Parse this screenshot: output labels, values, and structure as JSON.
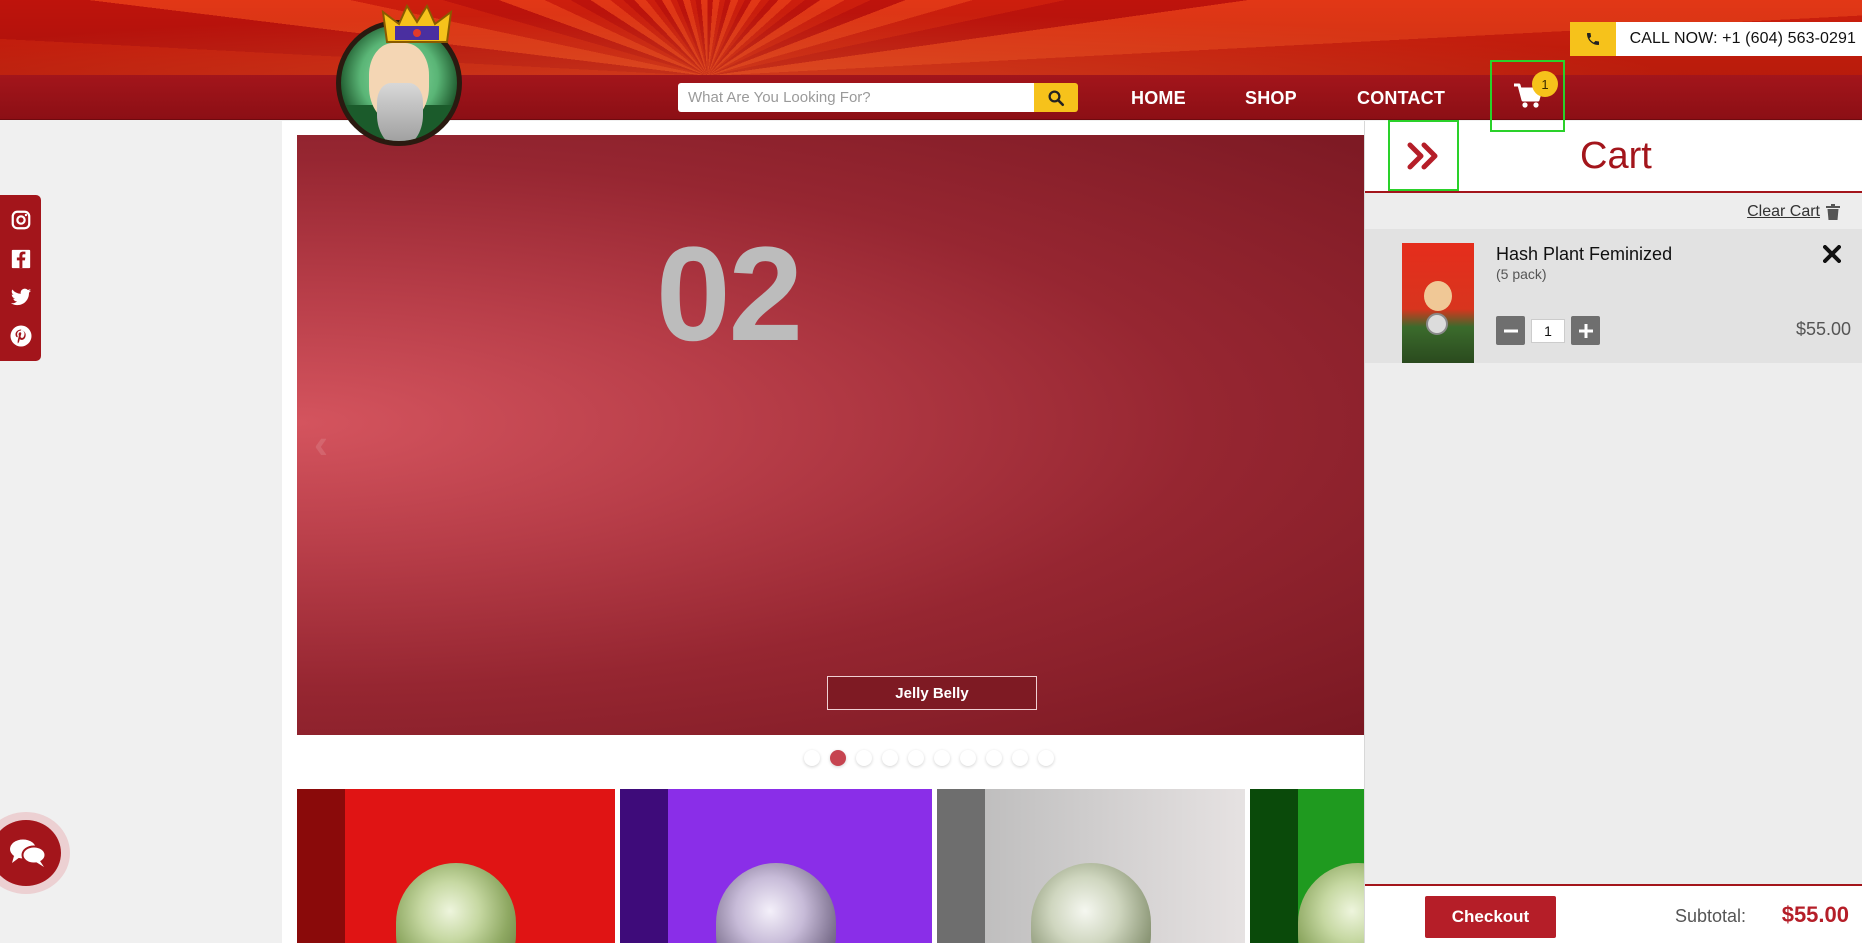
{
  "header": {
    "call": {
      "label": "CALL NOW: +1 (604) 563-0291",
      "icon": "phone-icon"
    },
    "search": {
      "placeholder": "What Are You Looking For?",
      "icon": "search-icon"
    },
    "nav": [
      {
        "label": "HOME"
      },
      {
        "label": "SHOP"
      },
      {
        "label": "CONTACT"
      }
    ],
    "cart": {
      "count": "1",
      "icon": "cart-icon"
    }
  },
  "social": [
    "instagram-icon",
    "facebook-icon",
    "twitter-icon",
    "pinterest-icon"
  ],
  "hero": {
    "slide_number": "02",
    "caption": "Jelly Belly",
    "dots_total": 10,
    "active_dot": 2
  },
  "cart_panel": {
    "title": "Cart",
    "clear_label": "Clear Cart",
    "items": [
      {
        "name": "Hash Plant Feminized",
        "variant": "(5 pack)",
        "quantity": "1",
        "price": "$55.00"
      }
    ],
    "checkout_label": "Checkout",
    "subtotal_label": "Subtotal:",
    "subtotal_value": "$55.00"
  },
  "colors": {
    "brand_red": "#a3151b",
    "accent_yellow": "#f6c21b",
    "highlight_green": "#2ad12a"
  }
}
